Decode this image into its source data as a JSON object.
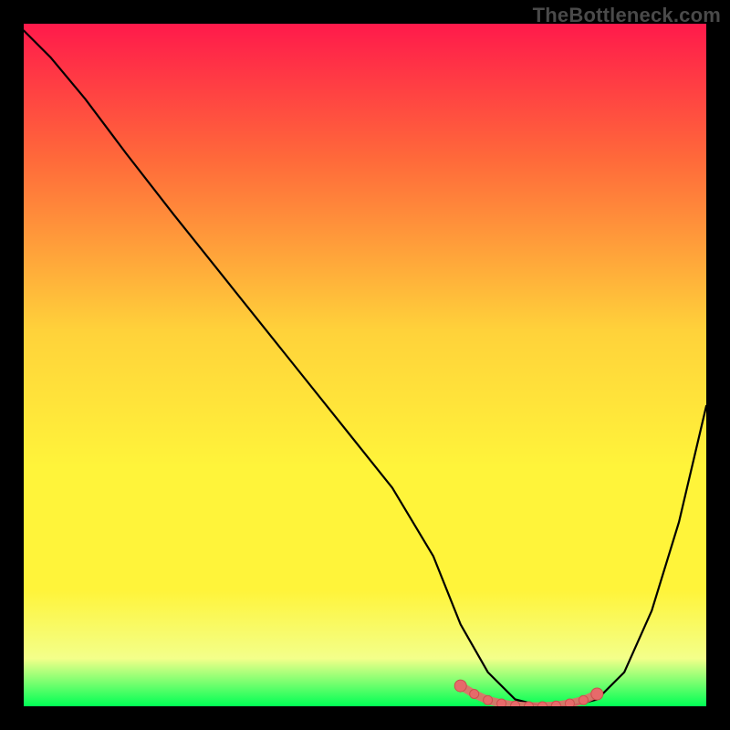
{
  "watermark": "TheBottleneck.com",
  "colors": {
    "frame": "#000000",
    "grad_top": "#ff1a4b",
    "grad_upper": "#ff6a3a",
    "grad_mid": "#ffd23a",
    "grad_lower_mid": "#fff43a",
    "grad_lower": "#f3ff8a",
    "grad_bottom": "#00ff55",
    "line": "#000000",
    "marker_fill": "#e76a6a",
    "marker_stroke": "#cc4f4f"
  },
  "chart_data": {
    "type": "line",
    "title": "",
    "xlabel": "",
    "ylabel": "",
    "xlim": [
      0,
      100
    ],
    "ylim": [
      0,
      100
    ],
    "series": [
      {
        "name": "bottleneck-curve",
        "x": [
          0,
          4,
          9,
          15,
          22,
          30,
          38,
          46,
          54,
          60,
          64,
          68,
          72,
          76,
          80,
          84,
          88,
          92,
          96,
          100
        ],
        "y": [
          99,
          95,
          89,
          81,
          72,
          62,
          52,
          42,
          32,
          22,
          12,
          5,
          1,
          0,
          0,
          1,
          5,
          14,
          27,
          44
        ]
      }
    ],
    "highlight": {
      "name": "optimal-zone",
      "x": [
        64,
        66,
        68,
        70,
        72,
        74,
        76,
        78,
        80,
        82,
        84
      ],
      "y": [
        3,
        1.8,
        0.9,
        0.4,
        0.1,
        0,
        0,
        0.1,
        0.4,
        0.9,
        1.8
      ]
    }
  }
}
